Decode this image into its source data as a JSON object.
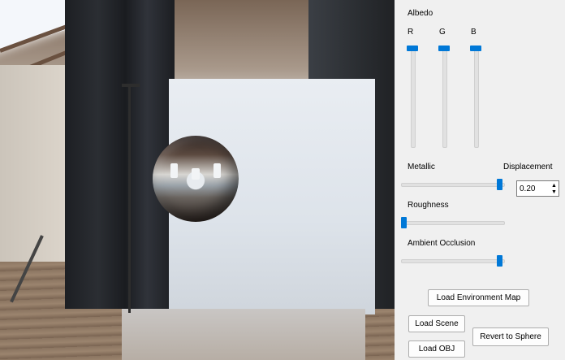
{
  "viewport": {
    "description_object": "chrome-sphere"
  },
  "panel": {
    "albedo_label": "Albedo",
    "channels": [
      {
        "label": "R",
        "value": 1.0
      },
      {
        "label": "G",
        "value": 1.0
      },
      {
        "label": "B",
        "value": 1.0
      }
    ],
    "metallic": {
      "label": "Metallic",
      "value": 1.0
    },
    "displacement": {
      "label": "Displacement",
      "value": "0.20"
    },
    "roughness": {
      "label": "Roughness",
      "value": 0.0
    },
    "ambient_occlusion": {
      "label": "Ambient Occlusion",
      "value": 1.0
    },
    "buttons": {
      "load_env_map": "Load Environment Map",
      "load_scene": "Load Scene",
      "revert_to_sphere": "Revert to Sphere",
      "load_obj": "Load OBJ"
    }
  },
  "colors": {
    "accent": "#0078d7",
    "panel_bg": "#f0f0f0"
  }
}
